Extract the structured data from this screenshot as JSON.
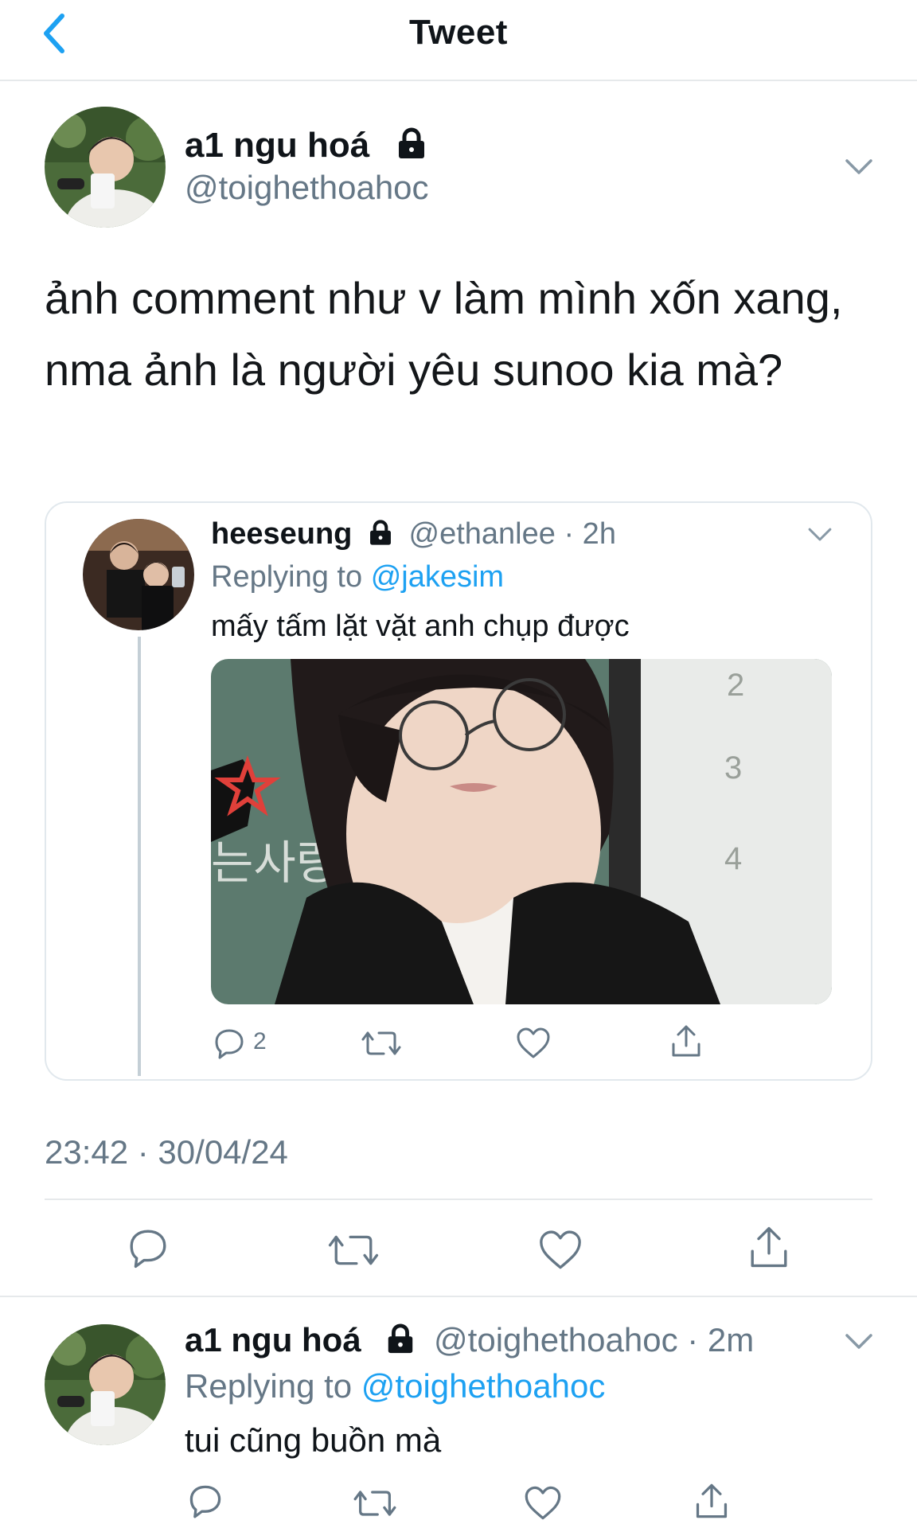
{
  "header": {
    "title": "Tweet"
  },
  "main_tweet": {
    "display_name": "a1 ngu hoá",
    "handle": "@toighethoahoc",
    "text": "ảnh comment như v làm mình xốn xang, nma ảnh là người yêu sunoo kia mà?",
    "timestamp": "23:42 · 30/04/24"
  },
  "quoted_tweet": {
    "display_name": "heeseung",
    "handle": "@ethanlee",
    "time": "· 2h",
    "replying_label": "Replying to",
    "replying_to": "@jakesim",
    "text": "mấy tấm lặt vặt anh chụp được",
    "reply_count": "2",
    "image_overlay_text": "는사랑"
  },
  "reply_tweet": {
    "display_name": "a1 ngu hoá",
    "handle": "@toighethoahoc",
    "time": "· 2m",
    "replying_label": "Replying to",
    "replying_to": "@toighethoahoc",
    "text": "tui cũng buồn mà"
  },
  "colors": {
    "accent": "#1da1f2",
    "muted": "#657786",
    "border": "#e6e9eb"
  },
  "icons": [
    "back-chevron-icon",
    "lock-icon",
    "chevron-down-icon",
    "reply-icon",
    "retweet-icon",
    "like-icon",
    "share-icon"
  ]
}
